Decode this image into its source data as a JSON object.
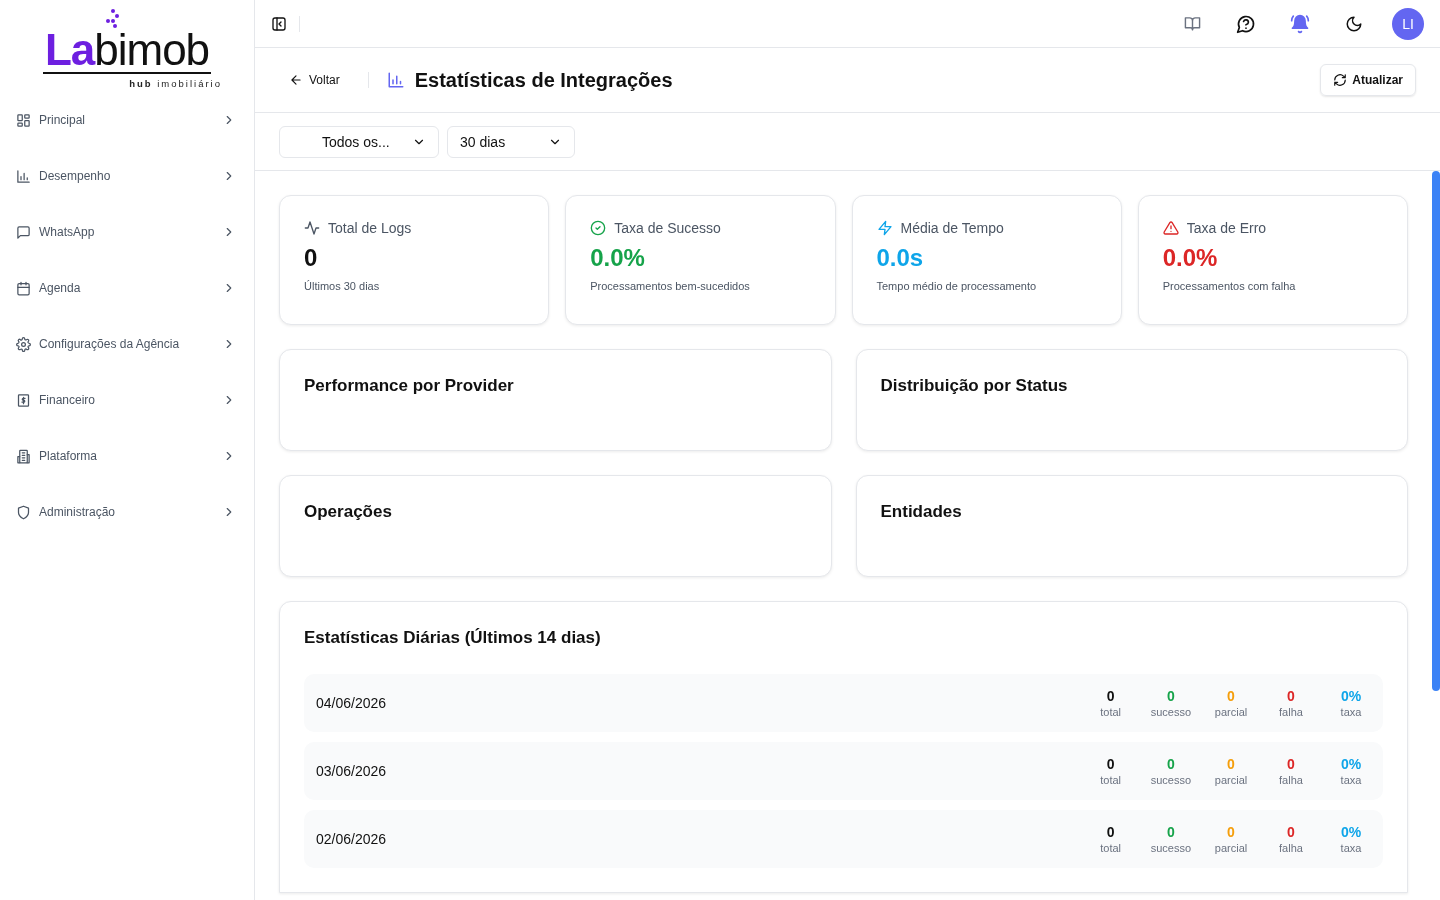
{
  "logo": {
    "brand_accent": "La",
    "brand_rest": "bimob",
    "tagline_bold": "hub",
    "tagline": "imobiliário"
  },
  "sidebar": {
    "items": [
      {
        "label": "Principal"
      },
      {
        "label": "Desempenho"
      },
      {
        "label": "WhatsApp"
      },
      {
        "label": "Agenda"
      },
      {
        "label": "Configurações da Agência"
      },
      {
        "label": "Financeiro"
      },
      {
        "label": "Plataforma"
      },
      {
        "label": "Administração"
      }
    ]
  },
  "topbar": {
    "avatar": "LI"
  },
  "header": {
    "back": "Voltar",
    "title": "Estatísticas de Integrações",
    "refresh": "Atualizar"
  },
  "filters": [
    {
      "value": "Todos os..."
    },
    {
      "value": "30 dias"
    }
  ],
  "stats": [
    {
      "title": "Total de Logs",
      "value": "0",
      "caption": "Últimos 30 dias",
      "color": "#111111"
    },
    {
      "title": "Taxa de Sucesso",
      "value": "0.0%",
      "caption": "Processamentos bem-sucedidos",
      "color": "#16a34a"
    },
    {
      "title": "Média de Tempo",
      "value": "0.0s",
      "caption": "Tempo médio de processamento",
      "color": "#0ea5e9"
    },
    {
      "title": "Taxa de Erro",
      "value": "0.0%",
      "caption": "Processamentos com falha",
      "color": "#dc2626"
    }
  ],
  "panels": [
    {
      "title": "Performance por Provider"
    },
    {
      "title": "Distribuição por Status"
    },
    {
      "title": "Operações"
    },
    {
      "title": "Entidades"
    }
  ],
  "daily": {
    "title": "Estatísticas Diárias (Últimos 14 dias)",
    "rows": [
      {
        "date": "04/06/2026",
        "metrics": [
          {
            "value": "0",
            "label": "total",
            "color": "#111111"
          },
          {
            "value": "0",
            "label": "sucesso",
            "color": "#16a34a"
          },
          {
            "value": "0",
            "label": "parcial",
            "color": "#f59e0b"
          },
          {
            "value": "0",
            "label": "falha",
            "color": "#dc2626"
          },
          {
            "value": "0%",
            "label": "taxa",
            "color": "#0ea5e9"
          }
        ]
      },
      {
        "date": "03/06/2026",
        "metrics": [
          {
            "value": "0",
            "label": "total",
            "color": "#111111"
          },
          {
            "value": "0",
            "label": "sucesso",
            "color": "#16a34a"
          },
          {
            "value": "0",
            "label": "parcial",
            "color": "#f59e0b"
          },
          {
            "value": "0",
            "label": "falha",
            "color": "#dc2626"
          },
          {
            "value": "0%",
            "label": "taxa",
            "color": "#0ea5e9"
          }
        ]
      },
      {
        "date": "02/06/2026",
        "metrics": [
          {
            "value": "0",
            "label": "total",
            "color": "#111111"
          },
          {
            "value": "0",
            "label": "sucesso",
            "color": "#16a34a"
          },
          {
            "value": "0",
            "label": "parcial",
            "color": "#f59e0b"
          },
          {
            "value": "0",
            "label": "falha",
            "color": "#dc2626"
          },
          {
            "value": "0%",
            "label": "taxa",
            "color": "#0ea5e9"
          }
        ]
      }
    ]
  }
}
